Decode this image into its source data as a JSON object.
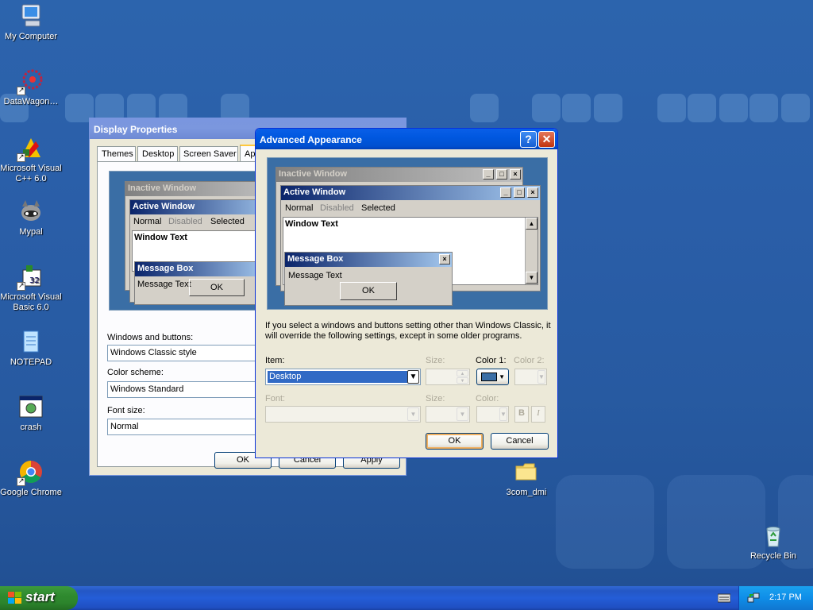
{
  "desktop": {
    "icons": [
      {
        "label": "My Computer",
        "icon": "computer-icon"
      },
      {
        "label": "DataWagon…",
        "icon": "datawagon-icon"
      },
      {
        "label": "Microsoft Visual C++ 6.0",
        "icon": "visual-cpp-icon"
      },
      {
        "label": "Mypal",
        "icon": "mypal-icon"
      },
      {
        "label": "Microsoft Visual Basic 6.0",
        "icon": "visual-basic-icon"
      },
      {
        "label": "NOTEPAD",
        "icon": "notepad-icon"
      },
      {
        "label": "crash",
        "icon": "crash-icon"
      },
      {
        "label": "Google Chrome",
        "icon": "chrome-icon"
      },
      {
        "label": "3com_dmi",
        "icon": "folder-icon"
      },
      {
        "label": "Recycle Bin",
        "icon": "recycle-bin-icon"
      }
    ]
  },
  "display_properties": {
    "title": "Display Properties",
    "tabs": [
      "Themes",
      "Desktop",
      "Screen Saver",
      "Ap"
    ],
    "preview": {
      "inactive_title": "Inactive Window",
      "active_title": "Active Window",
      "menu": [
        "Normal",
        "Disabled",
        "Selected"
      ],
      "window_text": "Window Text",
      "message_box_title": "Message Box",
      "message_text": "Message Text",
      "ok": "OK"
    },
    "windows_buttons_label": "Windows and buttons:",
    "windows_buttons_value": "Windows Classic style",
    "color_scheme_label": "Color scheme:",
    "color_scheme_value": "Windows Standard",
    "font_size_label": "Font size:",
    "font_size_value": "Normal",
    "buttons": [
      "OK",
      "Cancel",
      "Apply"
    ]
  },
  "advanced": {
    "title": "Advanced Appearance",
    "help_glyph": "?",
    "close_glyph": "✕",
    "preview": {
      "inactive_title": "Inactive Window",
      "active_title": "Active Window",
      "menu": [
        "Normal",
        "Disabled",
        "Selected"
      ],
      "window_text": "Window Text",
      "message_box_title": "Message Box",
      "message_text": "Message Text",
      "ok": "OK"
    },
    "info": "If you select a windows and buttons setting other than Windows Classic, it will override the following settings, except in some older programs.",
    "item_label": "Item:",
    "item_value": "Desktop",
    "size_label": "Size:",
    "color1_label": "Color 1:",
    "color1_value": "#3a6ea5",
    "color2_label": "Color 2:",
    "font_label": "Font:",
    "font_size_label": "Size:",
    "font_color_label": "Color:",
    "bold_label": "B",
    "italic_label": "I",
    "ok": "OK",
    "cancel": "Cancel"
  },
  "taskbar": {
    "start_label": "start",
    "time": "2:17 PM"
  }
}
